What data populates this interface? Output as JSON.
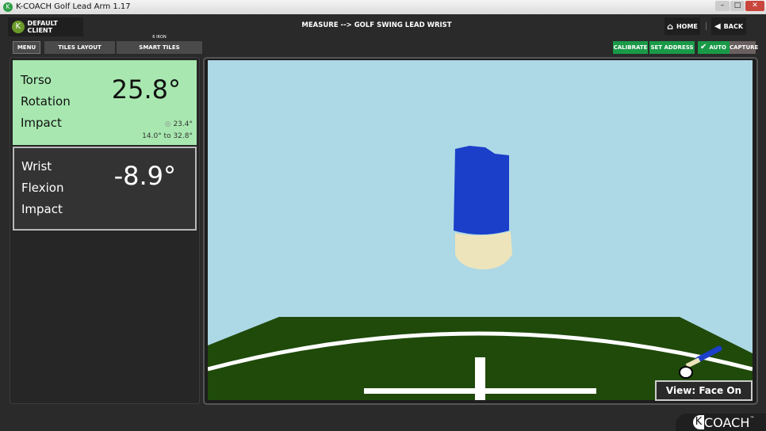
{
  "window": {
    "title": "K-COACH Golf Lead Arm 1.17",
    "logo_letter": "K"
  },
  "header": {
    "client": "DEFAULT CLIENT",
    "client_logo": "K",
    "title": "MEASURE --> GOLF SWING LEAD WRIST",
    "home": "HOME",
    "back": "BACK"
  },
  "tabs": {
    "menu": "MENU",
    "tiles_layout": "TILES LAYOUT",
    "smart_tiles": "SMART TILES",
    "club": "6 IRON"
  },
  "actions": {
    "calibrate": "CALIBRATE",
    "set_address": "SET ADDRESS",
    "auto": "AUTO",
    "capture": "CAPTURE"
  },
  "tiles": [
    {
      "lines": [
        "Torso",
        "Rotation",
        "Impact"
      ],
      "value": "25.8°",
      "target": "23.4°",
      "range": "14.0° to 32.8°",
      "bg": "#a8e8b0"
    },
    {
      "lines": [
        "Wrist",
        "Flexion",
        "Impact"
      ],
      "value": "-8.9°",
      "bg": "#333333"
    }
  ],
  "viewport": {
    "view_label": "View: Face On",
    "sky": "#add8e6",
    "ground": "#1f4a0a",
    "shirt": "#1b3fc9"
  },
  "brand": {
    "letter": "K",
    "name": "COACH",
    "tm": "™"
  },
  "colors": {
    "accent_green": "#1a9a48"
  }
}
